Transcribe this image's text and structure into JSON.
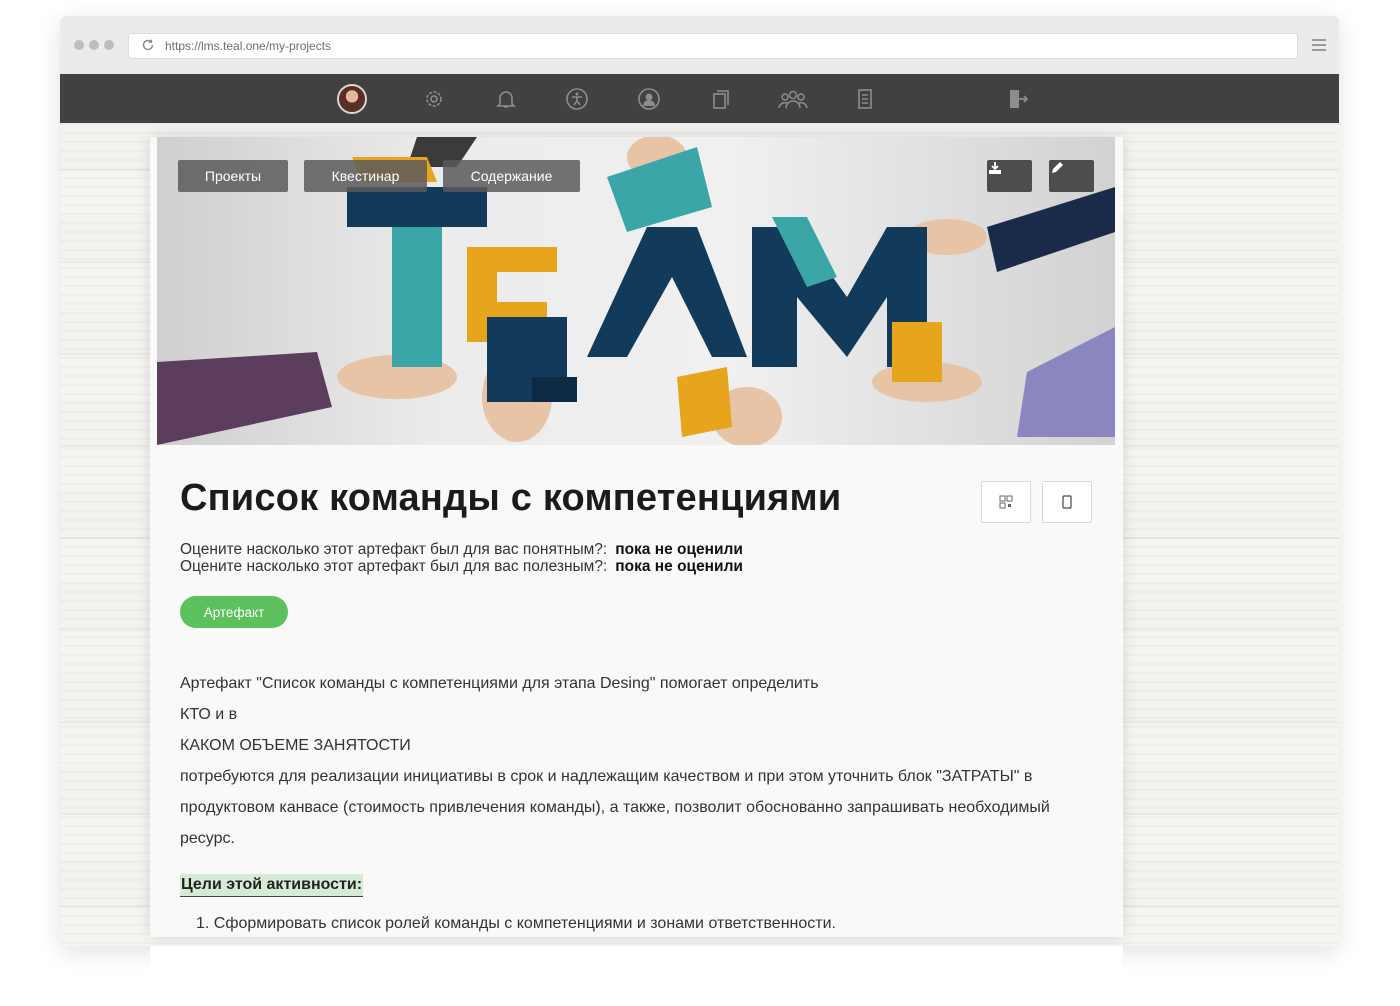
{
  "browser": {
    "url": "https://lms.teal.one/my-projects"
  },
  "nav": {
    "items": [
      "avatar",
      "gear-icon",
      "bell-icon",
      "accessibility-icon",
      "user-circle-icon",
      "copy-icon",
      "group-icon",
      "document-icon",
      "logout-icon"
    ]
  },
  "hero": {
    "tabs": [
      "Проекты",
      "Квестинар",
      "Содержание"
    ],
    "word": "TEAM",
    "colors": {
      "navy": "#123a5a",
      "teal": "#3aa6a8",
      "orange": "#e7a51e",
      "purple": "#5d3d5e",
      "lavender": "#8a86c0"
    }
  },
  "artifact": {
    "title": "Список команды с компетенциями",
    "rating_clear_label": "Оцените насколько этот артефакт был для вас понятным?:",
    "rating_clear_value": "пока не оценили",
    "rating_useful_label": "Оцените насколько этот артефакт был для вас полезным?:",
    "rating_useful_value": "пока не оценили",
    "badge": "Артефакт",
    "accent": "#5cc15c",
    "body": [
      "Артефакт \"Список команды с компетенциями для этапа Desing\" помогает определить",
      "КТО и в",
      "КАКОМ ОБЪЕМЕ ЗАНЯТОСТИ",
      "потребуются для реализации инициативы в срок и надлежащим качеством и при этом уточнить блок \"ЗАТРАТЫ\" в",
      "продуктовом канвасе (стоимость привлечения команды),  а также, позволит обоснованно запрашивать необходимый",
      "ресурс."
    ],
    "goals_heading": "Цели этой активности:",
    "goals": [
      "1. Сформировать список ролей команды с компетенциями и зонами ответственности."
    ]
  }
}
